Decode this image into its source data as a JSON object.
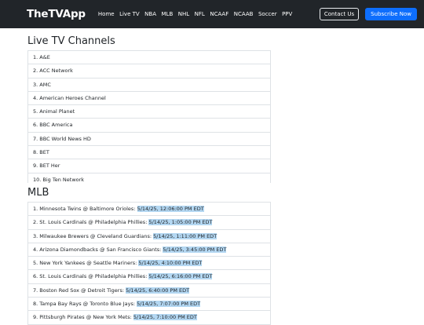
{
  "brand": "TheTVApp",
  "nav": [
    "Home",
    "Live TV",
    "NBA",
    "MLB",
    "NHL",
    "NFL",
    "NCAAF",
    "NCAAB",
    "Soccer",
    "PPV"
  ],
  "contact_button": "Contact Us",
  "subscribe_button": "Subscribe Now",
  "live_title": "Live TV Channels",
  "channels": [
    "1. A&E",
    "2. ACC Network",
    "3. AMC",
    "4. American Heroes Channel",
    "5. Animal Planet",
    "6. BBC America",
    "7. BBC World News HD",
    "8. BET",
    "9. BET Her",
    "10. Big Ten Network"
  ],
  "mlb_title": "MLB",
  "games": [
    {
      "label": "1. Minnesota Twins @ Baltimore Orioles: ",
      "time": "5/14/25, 12:06:00 PM EDT"
    },
    {
      "label": "2. St. Louis Cardinals @ Philadelphia Phillies: ",
      "time": "5/14/25, 1:05:00 PM EDT"
    },
    {
      "label": "3. Milwaukee Brewers @ Cleveland Guardians: ",
      "time": "5/14/25, 1:11:00 PM EDT"
    },
    {
      "label": "4. Arizona Diamondbacks @ San Francisco Giants: ",
      "time": "5/14/25, 3:45:00 PM EDT"
    },
    {
      "label": "5. New York Yankees @ Seattle Mariners: ",
      "time": "5/14/25, 4:10:00 PM EDT"
    },
    {
      "label": "6. St. Louis Cardinals @ Philadelphia Phillies: ",
      "time": "5/14/25, 6:16:00 PM EDT"
    },
    {
      "label": "7. Boston Red Sox @ Detroit Tigers: ",
      "time": "5/14/25, 6:40:00 PM EDT"
    },
    {
      "label": "8. Tampa Bay Rays @ Toronto Blue Jays: ",
      "time": "5/14/25, 7:07:00 PM EDT"
    },
    {
      "label": "9. Pittsburgh Pirates @ New York Mets: ",
      "time": "5/14/25, 7:10:00 PM EDT"
    }
  ]
}
